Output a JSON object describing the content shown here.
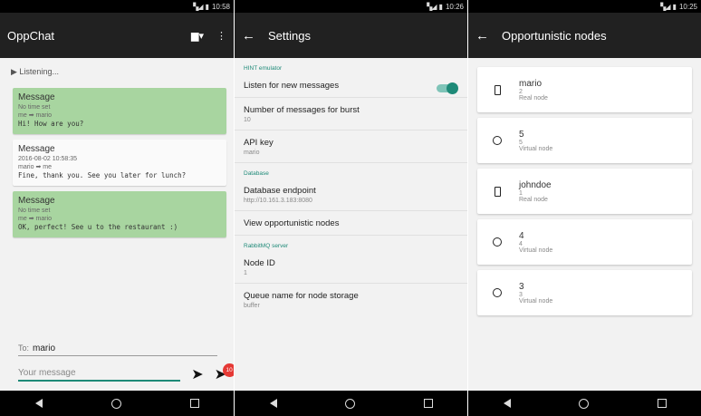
{
  "screens": {
    "chat": {
      "status_time": "10:58",
      "title": "OppChat",
      "listening": "▶ Listening...",
      "messages": [
        {
          "title": "Message",
          "time": "No time set",
          "from": "me",
          "to": "mario",
          "text": "Hi! How are you?"
        },
        {
          "title": "Message",
          "time": "2016-08-02 10:58:35",
          "from": "mario",
          "to": "me",
          "text": "Fine, thank you. See you later for lunch?"
        },
        {
          "title": "Message",
          "time": "No time set",
          "from": "me",
          "to": "mario",
          "text": "OK, perfect! See u to the restaurant :)"
        }
      ],
      "to_label": "To:",
      "to_value": "mario",
      "message_placeholder": "Your message",
      "burst_badge": "10"
    },
    "settings": {
      "status_time": "10:26",
      "title": "Settings",
      "hint_section": "HINT emulator",
      "listen_label": "Listen for new messages",
      "burst_label": "Number of messages for burst",
      "burst_value": "10",
      "api_key_label": "API key",
      "api_key_value": "mario",
      "database_section": "Database",
      "db_endpoint_label": "Database endpoint",
      "db_endpoint_value": "http://10.161.3.183:8080",
      "view_nodes_label": "View opportunistic nodes",
      "rabbit_section": "RabbitMQ server",
      "node_id_label": "Node ID",
      "node_id_value": "1",
      "queue_label": "Queue name for node storage",
      "queue_value": "buffer"
    },
    "nodes": {
      "status_time": "10:25",
      "title": "Opportunistic nodes",
      "items": [
        {
          "name": "mario",
          "id": "2",
          "type": "Real node"
        },
        {
          "name": "5",
          "id": "5",
          "type": "Virtual node"
        },
        {
          "name": "johndoe",
          "id": "1",
          "type": "Real node"
        },
        {
          "name": "4",
          "id": "4",
          "type": "Virtual node"
        },
        {
          "name": "3",
          "id": "3",
          "type": "Virtual node"
        }
      ]
    }
  },
  "colors": {
    "accent": "#1e8a78",
    "message_green": "#a8d5a0",
    "badge_red": "#e53935",
    "appbar": "#212121"
  },
  "icons": [
    "back-arrow-icon",
    "overflow-menu-icon",
    "filter-icon",
    "send-icon",
    "send-burst-icon",
    "phone-icon",
    "virtual-node-icon",
    "nav-back-icon",
    "nav-home-icon",
    "nav-recent-icon",
    "signal-icon",
    "battery-icon"
  ]
}
